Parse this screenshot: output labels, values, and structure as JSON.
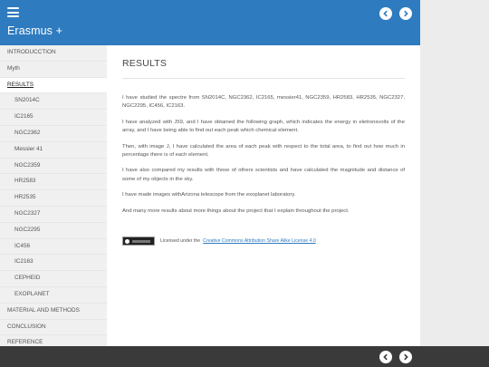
{
  "header": {
    "title": "Erasmus +",
    "menu_icon": "hamburger-menu-icon",
    "prev_icon": "chevron-left-icon",
    "next_icon": "chevron-right-icon"
  },
  "sidebar": {
    "items": [
      {
        "label": "INTRODUCCTION",
        "level": 0,
        "active": false
      },
      {
        "label": "Myth",
        "level": 0,
        "active": false
      },
      {
        "label": "RESULTS",
        "level": 0,
        "active": true
      },
      {
        "label": "SN2014C",
        "level": 1,
        "active": false
      },
      {
        "label": "IC2165",
        "level": 1,
        "active": false
      },
      {
        "label": "NGC2362",
        "level": 1,
        "active": false
      },
      {
        "label": "Messier 41",
        "level": 1,
        "active": false
      },
      {
        "label": "NGC2359",
        "level": 1,
        "active": false
      },
      {
        "label": "HR2583",
        "level": 1,
        "active": false
      },
      {
        "label": "HR2535",
        "level": 1,
        "active": false
      },
      {
        "label": "NGC2327",
        "level": 1,
        "active": false
      },
      {
        "label": "NGC2295",
        "level": 1,
        "active": false
      },
      {
        "label": "IC456",
        "level": 1,
        "active": false
      },
      {
        "label": "IC2163",
        "level": 1,
        "active": false
      },
      {
        "label": "CEPHEID",
        "level": 1,
        "active": false
      },
      {
        "label": "EXOPLANET",
        "level": 1,
        "active": false
      },
      {
        "label": "MATERIAL AND METHODS",
        "level": 0,
        "active": false
      },
      {
        "label": "CONCLUSION",
        "level": 0,
        "active": false
      },
      {
        "label": "REFERENCE",
        "level": 0,
        "active": false
      }
    ]
  },
  "main": {
    "title": "RESULTS",
    "paragraphs": [
      "I have studied the spectre from SN2014C, NGC2362, IC2165, messier41, NGC2359, HR2583, HR2535, NGC2327, NGC2295, IC456, IC2163.",
      "I have analyzed with J59, and I have obtained the following graph, which indicates the energy in eletronsvolts of the array, and I have being able to find out each peak which chemical element.",
      "Then, with image J, I have calculated the area of each peak with respect to the total area, to find out how much in percentage there is of each element.",
      "I have also compared my results with those of others scientists and have calculated the magnitude and distance of some of my objects in the sky.",
      "I have made images withArizona telescope from the exoplanet laboratory.",
      "And many more results about more things about the project that I explain throughout the project."
    ],
    "license": {
      "prefix": "Licensed under the",
      "link_text": "Creative Commons Attribution Share Alike License 4.0",
      "badge_icon": "cc-by-sa-badge-icon"
    }
  },
  "colors": {
    "header": "#2f7bbf",
    "sidebar": "#f0f0f0",
    "footer": "#3a3a3a",
    "link": "#2f7bbf"
  }
}
